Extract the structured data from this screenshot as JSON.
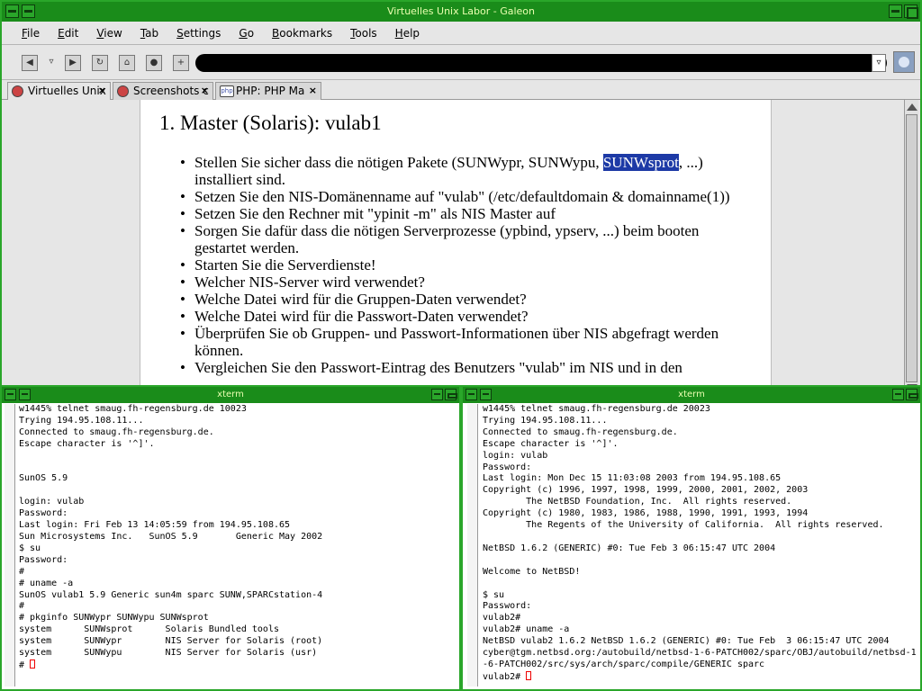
{
  "galeon": {
    "window_title": "Virtuelles Unix Labor - Galeon",
    "menu": [
      "File",
      "Edit",
      "View",
      "Tab",
      "Settings",
      "Go",
      "Bookmarks",
      "Tools",
      "Help"
    ],
    "tabs": [
      {
        "label": "Virtuelles Unix",
        "icon": "galeon-favicon-icon"
      },
      {
        "label": "Screenshots c",
        "icon": "galeon-favicon-icon"
      },
      {
        "label": "PHP: PHP Ma",
        "icon": "php-favicon-icon",
        "icon_text": "php"
      }
    ],
    "page": {
      "heading": "1. Master (Solaris): vulab1",
      "item1_before": "Stellen Sie sicher dass die nötigen Pakete (SUNWypr, SUNWypu, ",
      "item1_highlight": "SUNWsprot",
      "item1_after": ", ...) installiert sind.",
      "items": [
        "Setzen Sie den NIS-Domänenname auf \"vulab\" (/etc/defaultdomain & domainname(1))",
        "Setzen Sie den Rechner mit \"ypinit -m\" als NIS Master auf",
        "Sorgen Sie dafür dass die nötigen Serverprozesse (ypbind, ypserv, ...) beim booten gestartet werden.",
        "Starten Sie die Serverdienste!",
        "Welcher NIS-Server wird verwendet?",
        "Welche Datei wird für die Gruppen-Daten verwendet?",
        "Welche Datei wird für die Passwort-Daten verwendet?",
        "Überprüfen Sie ob Gruppen- und Passwort-Informationen über NIS abgefragt werden können.",
        "Vergleichen Sie den Passwort-Eintrag des Benutzers \"vulab\" im NIS und in den"
      ]
    }
  },
  "xterm_left": {
    "title": "xterm",
    "lines": [
      "w1445% telnet smaug.fh-regensburg.de 10023",
      "Trying 194.95.108.11...",
      "Connected to smaug.fh-regensburg.de.",
      "Escape character is '^]'.",
      "",
      "",
      "SunOS 5.9",
      "",
      "login: vulab",
      "Password:",
      "Last login: Fri Feb 13 14:05:59 from 194.95.108.65",
      "Sun Microsystems Inc.   SunOS 5.9       Generic May 2002",
      "$ su",
      "Password:",
      "#",
      "# uname -a",
      "SunOS vulab1 5.9 Generic sun4m sparc SUNW,SPARCstation-4",
      "#",
      "# pkginfo SUNWypr SUNWypu SUNWsprot",
      "system      SUNWsprot      Solaris Bundled tools",
      "system      SUNWypr        NIS Server for Solaris (root)",
      "system      SUNWypu        NIS Server for Solaris (usr)"
    ],
    "prompt": "# "
  },
  "xterm_right": {
    "title": "xterm",
    "lines": [
      "w1445% telnet smaug.fh-regensburg.de 20023",
      "Trying 194.95.108.11...",
      "Connected to smaug.fh-regensburg.de.",
      "Escape character is '^]'.",
      "login: vulab",
      "Password:",
      "Last login: Mon Dec 15 11:03:08 2003 from 194.95.108.65",
      "Copyright (c) 1996, 1997, 1998, 1999, 2000, 2001, 2002, 2003",
      "        The NetBSD Foundation, Inc.  All rights reserved.",
      "Copyright (c) 1980, 1983, 1986, 1988, 1990, 1991, 1993, 1994",
      "        The Regents of the University of California.  All rights reserved.",
      "",
      "NetBSD 1.6.2 (GENERIC) #0: Tue Feb 3 06:15:47 UTC 2004",
      "",
      "Welcome to NetBSD!",
      "",
      "$ su",
      "Password:",
      "vulab2#",
      "vulab2# uname -a",
      "NetBSD vulab2 1.6.2 NetBSD 1.6.2 (GENERIC) #0: Tue Feb  3 06:15:47 UTC 2004",
      "cyber@tgm.netbsd.org:/autobuild/netbsd-1-6-PATCH002/sparc/OBJ/autobuild/netbsd-1",
      "-6-PATCH002/src/sys/arch/sparc/compile/GENERIC sparc"
    ],
    "prompt": "vulab2# "
  }
}
